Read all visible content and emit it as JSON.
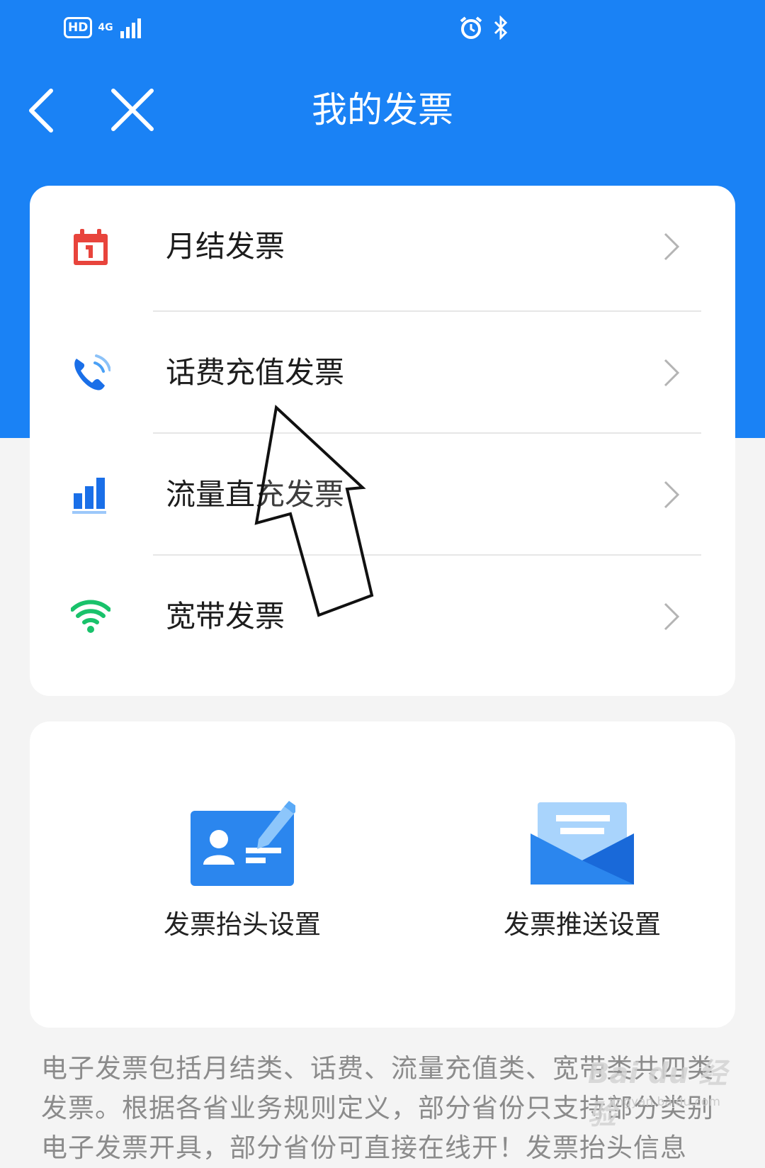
{
  "status_bar": {
    "hd": "HD",
    "network": "4G"
  },
  "header": {
    "title": "我的发票"
  },
  "invoice_menu": [
    {
      "label": "月结发票",
      "icon": "calendar-icon"
    },
    {
      "label": "话费充值发票",
      "icon": "phone-icon"
    },
    {
      "label": "流量直充发票",
      "icon": "bar-chart-icon"
    },
    {
      "label": "宽带发票",
      "icon": "wifi-icon"
    }
  ],
  "settings": {
    "title_setting": "发票抬头设置",
    "push_setting": "发票推送设置"
  },
  "note": "电子发票包括月结类、话费、流量充值类、宽带类共四类发票。根据各省业务规则定义，部分省份只支持部分类别电子发票开具，部分省份可直接在线开！发票抬头信息",
  "watermark": {
    "brand": "Bai du 经验",
    "url": "jingyan.baidu.com"
  },
  "colors": {
    "primary": "#1a82f5",
    "background": "#f4f4f4",
    "calendar": "#e8443c",
    "wifi": "#19c26b"
  }
}
